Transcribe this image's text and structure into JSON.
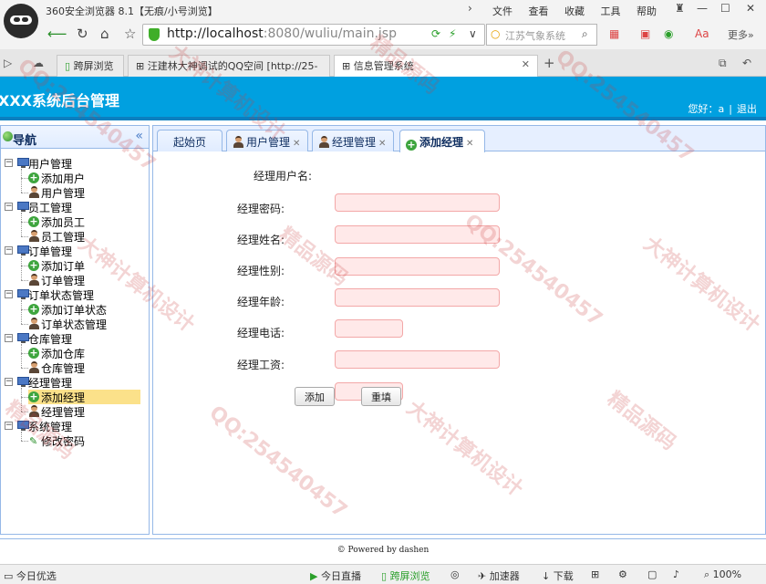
{
  "browser": {
    "title": "360安全浏览器 8.1【无痕/小号浏览】",
    "menus": [
      "文件",
      "查看",
      "收藏",
      "工具",
      "帮助"
    ],
    "url_host": "http://localhost",
    "url_rest": ":8080/wuliu/main.jsp",
    "search_text": "江苏气象系统",
    "more_label": "更多»",
    "tabs": [
      {
        "label": "跨屏浏览"
      },
      {
        "label": "汪建林大神调试的QQ空间 [http://25-"
      },
      {
        "label": "信息管理系统"
      }
    ]
  },
  "app": {
    "title": "XXX系统后台管理",
    "greeting": "您好：a",
    "logout": "退出"
  },
  "sidebar": {
    "title": "导航",
    "groups": [
      {
        "label": "用户管理",
        "children": [
          {
            "label": "添加用户",
            "icon": "add"
          },
          {
            "label": "用户管理",
            "icon": "user"
          }
        ]
      },
      {
        "label": "员工管理",
        "children": [
          {
            "label": "添加员工",
            "icon": "add"
          },
          {
            "label": "员工管理",
            "icon": "user"
          }
        ]
      },
      {
        "label": "订单管理",
        "children": [
          {
            "label": "添加订单",
            "icon": "add"
          },
          {
            "label": "订单管理",
            "icon": "user"
          }
        ]
      },
      {
        "label": "订单状态管理",
        "children": [
          {
            "label": "添加订单状态",
            "icon": "add"
          },
          {
            "label": "订单状态管理",
            "icon": "user"
          }
        ]
      },
      {
        "label": "仓库管理",
        "children": [
          {
            "label": "添加仓库",
            "icon": "add"
          },
          {
            "label": "仓库管理",
            "icon": "user"
          }
        ]
      },
      {
        "label": "经理管理",
        "children": [
          {
            "label": "添加经理",
            "icon": "add",
            "selected": true
          },
          {
            "label": "经理管理",
            "icon": "user"
          }
        ]
      },
      {
        "label": "系统管理",
        "children": [
          {
            "label": "修改密码",
            "icon": "pencil"
          }
        ]
      }
    ]
  },
  "main": {
    "tabs": [
      {
        "label": "起始页",
        "icon": "none",
        "closable": false
      },
      {
        "label": "用户管理",
        "icon": "user",
        "closable": true
      },
      {
        "label": "经理管理",
        "icon": "user",
        "closable": true
      },
      {
        "label": "添加经理",
        "icon": "add",
        "closable": true,
        "active": true
      }
    ],
    "form": {
      "fields": [
        {
          "label": "经理用户名:",
          "value": ""
        },
        {
          "label": "经理密码:",
          "value": ""
        },
        {
          "label": "经理姓名:",
          "value": ""
        },
        {
          "label": "经理性别:",
          "value": ""
        },
        {
          "label": "经理年龄:",
          "value": ""
        },
        {
          "label": "经理电话:",
          "value": ""
        },
        {
          "label": "经理工资:",
          "value": ""
        }
      ],
      "submit_label": "添加",
      "reset_label": "重填"
    },
    "footer": "© Powered by dashen"
  },
  "statusbar": {
    "left": "今日优选",
    "live": "今日直播",
    "cross": "跨屏浏览",
    "accel": "加速器",
    "download": "下载",
    "zoom": "100%"
  },
  "watermarks": [
    "QQ:254540457",
    "大神计算机设计",
    "精品源码",
    "QQ:254540457",
    "大神计算机设计",
    "精品源码",
    "QQ:254540457",
    "大神计算机设计",
    "精品源码",
    "QQ:254540457",
    "大神计算机设计",
    "精品源码"
  ],
  "colors": {
    "header": "#00a0e0",
    "panel_border": "#95b8e7",
    "input_bg": "#ffe9e9",
    "selected": "#fbe18a"
  }
}
